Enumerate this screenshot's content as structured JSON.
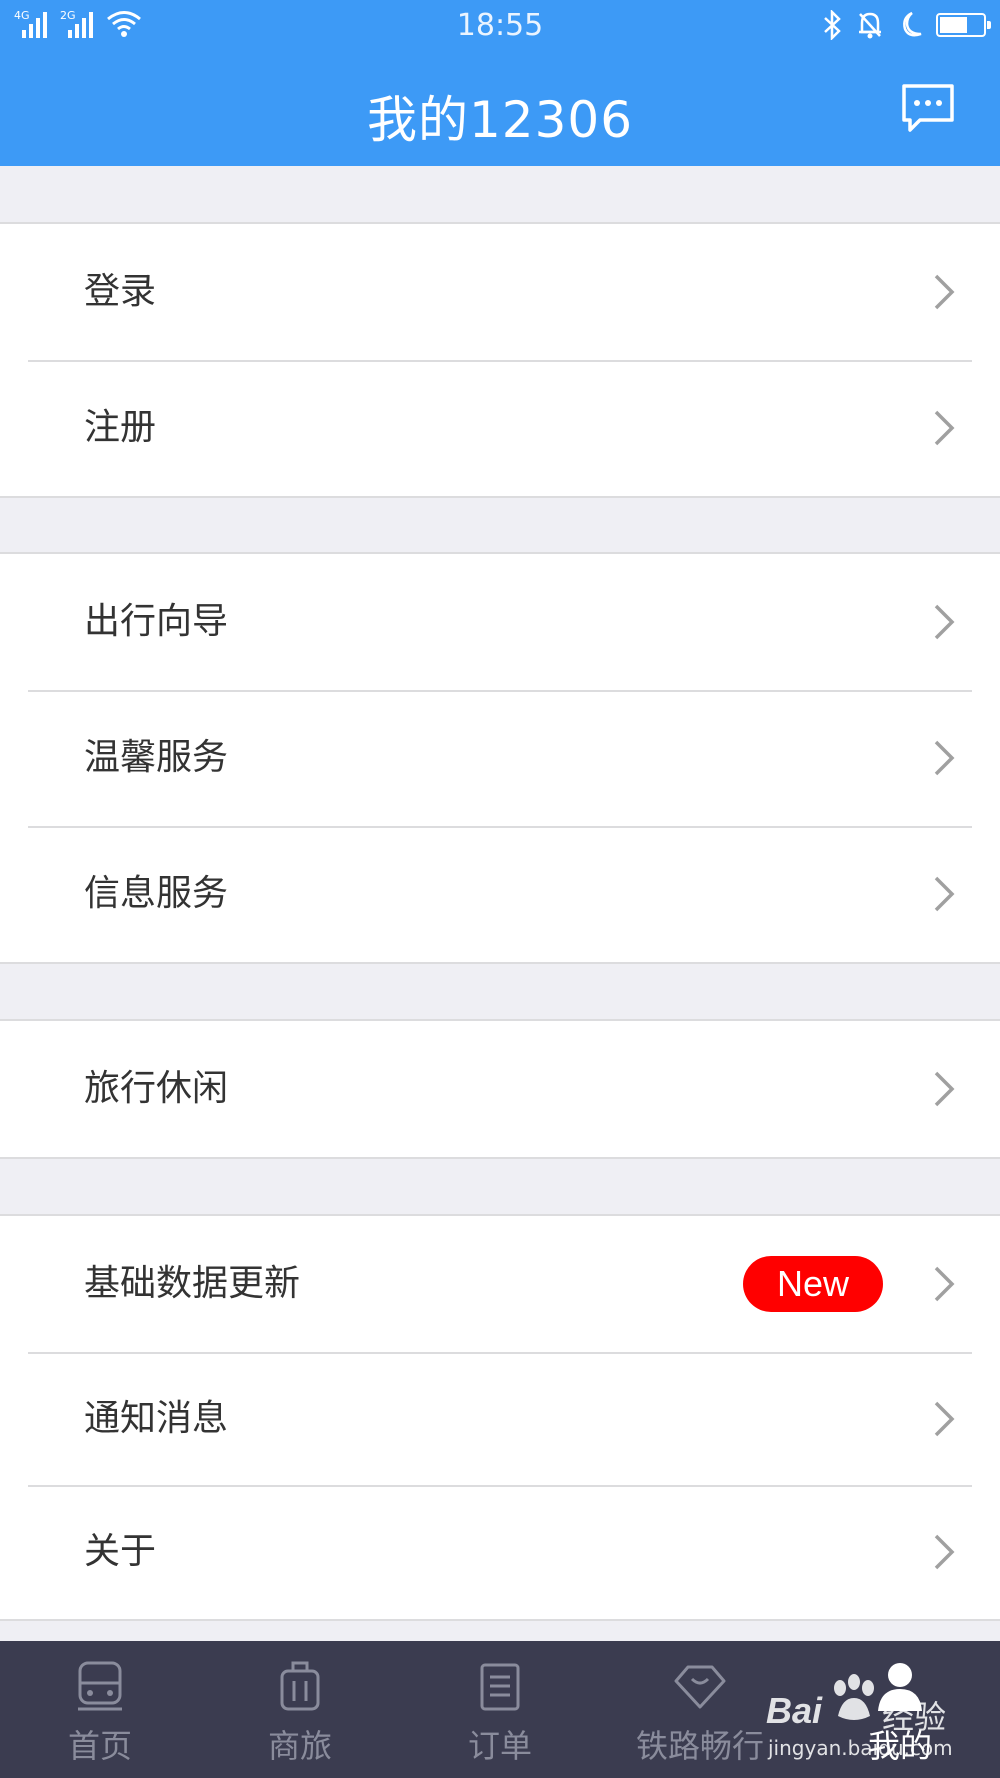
{
  "status_bar": {
    "time": "18:55",
    "network_1": "4G",
    "network_2": "2G",
    "icons": [
      "signal-icon",
      "wifi-icon",
      "bluetooth-icon",
      "alarm-icon",
      "moon-icon",
      "battery-icon"
    ],
    "battery_level": 0.65
  },
  "header": {
    "title": "我的12306",
    "message_icon": "message-icon"
  },
  "menu_groups": [
    {
      "items": [
        {
          "label": "登录"
        },
        {
          "label": "注册"
        }
      ]
    },
    {
      "items": [
        {
          "label": "出行向导"
        },
        {
          "label": "温馨服务"
        },
        {
          "label": "信息服务"
        }
      ]
    },
    {
      "items": [
        {
          "label": "旅行休闲"
        }
      ]
    },
    {
      "items": [
        {
          "label": "基础数据更新",
          "badge": "New"
        },
        {
          "label": "通知消息"
        },
        {
          "label": "关于"
        }
      ]
    }
  ],
  "tab_bar": {
    "tabs": [
      {
        "label": "首页",
        "icon": "train-icon"
      },
      {
        "label": "商旅",
        "icon": "luggage-icon"
      },
      {
        "label": "订单",
        "icon": "clipboard-icon"
      },
      {
        "label": "铁路畅行",
        "icon": "diamond-icon"
      },
      {
        "label": "我的",
        "icon": "user-icon",
        "active": true
      }
    ]
  },
  "watermark": {
    "brand": "Bai",
    "brand_cn": "经验",
    "domain": "jingyan.baidu.com"
  },
  "colors": {
    "header_bg": "#3d9af6",
    "page_bg": "#efeff4",
    "tab_bg": "#3b3c50",
    "badge_bg": "#ff0000"
  }
}
